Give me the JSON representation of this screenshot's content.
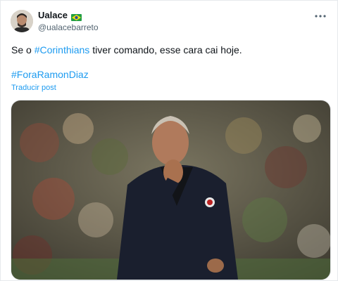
{
  "tweet": {
    "author": {
      "display_name": "Ualace",
      "flag_icon": "brazil-flag-icon",
      "handle": "@ualacebarreto"
    },
    "text_prefix": "Se o ",
    "text_hashtag": "#Corinthians",
    "text_suffix": " tiver comando, esse cara cai hoje.",
    "hashtag_line": "#ForaRamonDiaz",
    "translate_label": "Traducir post",
    "more_icon": "more-options-icon",
    "media_alt": "photo"
  },
  "colors": {
    "accent": "#1d9bf0",
    "text": "#0f1419",
    "secondary": "#536471"
  }
}
